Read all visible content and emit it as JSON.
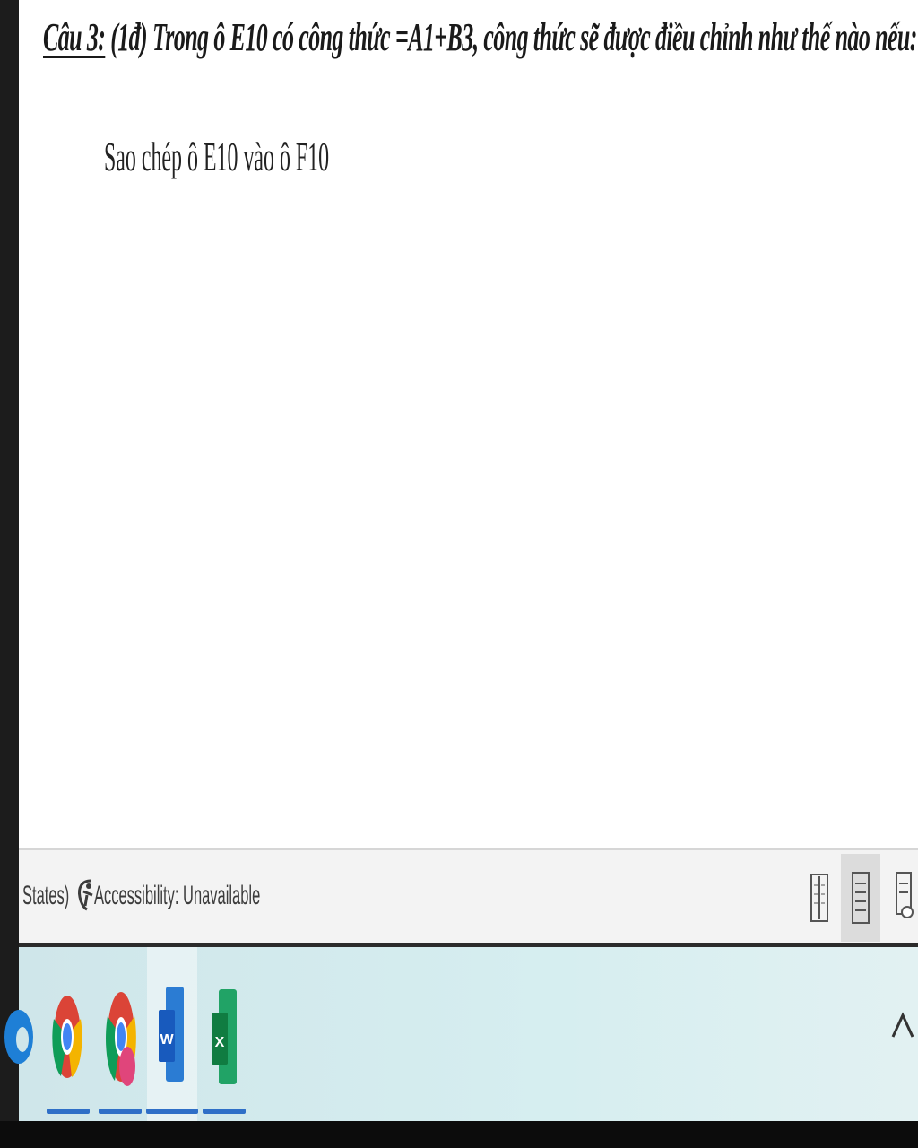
{
  "document": {
    "question_label": "Câu 3:",
    "question_text": " (1đ) Trong ô E10 có công thức =A1+B3, công thức sẽ được điều chỉnh như thế nào nếu:",
    "answer_line": "Sao chép ô E10 vào ô F10"
  },
  "statusbar": {
    "language_fragment": "States)",
    "accessibility": "Accessibility: Unavailable",
    "view_buttons": [
      "read-mode-icon",
      "print-layout-icon",
      "web-layout-icon"
    ]
  },
  "taskbar": {
    "apps": [
      "edge-icon",
      "chrome-icon",
      "chrome-profile-icon",
      "word-icon",
      "excel-icon"
    ],
    "overflow_icon": "chevron-up-icon",
    "colors": {
      "running_indicator": "#2f6fc7",
      "word": "#185abd",
      "excel": "#107c41"
    }
  }
}
